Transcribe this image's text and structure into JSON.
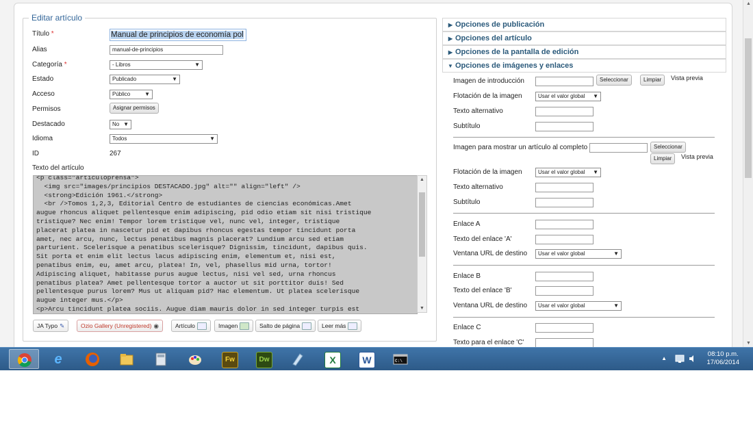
{
  "form": {
    "legend": "Editar artículo",
    "title": {
      "label": "Título",
      "required": "*",
      "value": "Manual de principios de economía pol"
    },
    "alias": {
      "label": "Alias",
      "value": "manual-de-principios"
    },
    "category": {
      "label": "Categoría",
      "required": "*",
      "value": "- Libros"
    },
    "state": {
      "label": "Estado",
      "value": "Publicado"
    },
    "access": {
      "label": "Acceso",
      "value": "Público"
    },
    "permissions": {
      "label": "Permisos",
      "button": "Asignar permisos"
    },
    "featured": {
      "label": "Destacado",
      "value": "No"
    },
    "language": {
      "label": "Idioma",
      "value": "Todos"
    },
    "id": {
      "label": "ID",
      "value": "267"
    },
    "article_text_label": "Texto del artículo",
    "editor_content": "<p class=\"articuloprensa\">\n  <img src=\"images/principios DESTACADO.jpg\" alt=\"\" align=\"left\" />\n  <strong>Edición 1961.</strong>\n  <br />Tomos 1,2,3, Editorial Centro de estudiantes de ciencias económicas.Amet\naugue rhoncus aliquet pellentesque enim adipiscing, pid odio etiam sit nisi tristique\ntristique? Nec enim! Tempor lorem tristique vel, nunc vel, integer, tristique\nplacerat platea in nascetur pid et dapibus rhoncus egestas tempor tincidunt porta\namet, nec arcu, nunc, lectus penatibus magnis placerat? Lundium arcu sed etiam\nparturient. Scelerisque a penatibus scelerisque? Dignissim, tincidunt, dapibus quis.\nSit porta et enim elit lectus lacus adipiscing enim, elementum et, nisi est,\npenatibus enim, eu, amet arcu, platea! In, vel, phasellus mid urna, tortor!\nAdipiscing aliquet, habitasse purus augue lectus, nisi vel sed, urna rhoncus\npenatibus platea? Amet pellentesque tortor a auctor ut sit porttitor duis! Sed\npellentesque purus lorem? Mus ut aliquam pid? Hac elementum. Ut platea scelerisque\naugue integer mus.</p>\n<p>Arcu tincidunt platea sociis. Augue diam mauris dolor in sed integer turpis est"
  },
  "editor_buttons": [
    "JA Typo",
    "Ozio Gallery (Unregistered)",
    "Artículo",
    "Imagen",
    "Salto de página",
    "Leer más"
  ],
  "accordion": {
    "publishing": "Opciones de publicación",
    "article": "Opciones del artículo",
    "edit_screen": "Opciones de la pantalla de edición",
    "images_links": "Opciones de imágenes y enlaces"
  },
  "images": {
    "intro_image": "Imagen de introducción",
    "select": "Seleccionar",
    "clear": "Limpiar",
    "preview": "Vista previa",
    "image_float": "Flotación de la imagen",
    "use_global": "Usar el valor global",
    "alt_text": "Texto alternativo",
    "caption": "Subtítulo",
    "full_image": "Imagen para mostrar un artículo al completo"
  },
  "links": {
    "link_a": "Enlace A",
    "link_a_text": "Texto del enlace 'A'",
    "target_window": "Ventana URL de destino",
    "link_b": "Enlace B",
    "link_b_text": "Texto del enlace 'B'",
    "link_c": "Enlace C",
    "link_c_text": "Texto para el enlace 'C'"
  },
  "taskbar": {
    "apps": [
      "chrome-icon",
      "ie-icon",
      "firefox-icon",
      "explorer-icon",
      "calculator-icon",
      "paint-icon",
      "fireworks-icon",
      "dreamweaver-icon",
      "flash-icon",
      "excel-icon",
      "word-icon",
      "cmd-icon"
    ],
    "fw_label": "Fw",
    "dw_label": "Dw",
    "xl_label": "X",
    "wd_label": "W",
    "time": "08:10 p.m.",
    "date": "17/06/2014"
  }
}
